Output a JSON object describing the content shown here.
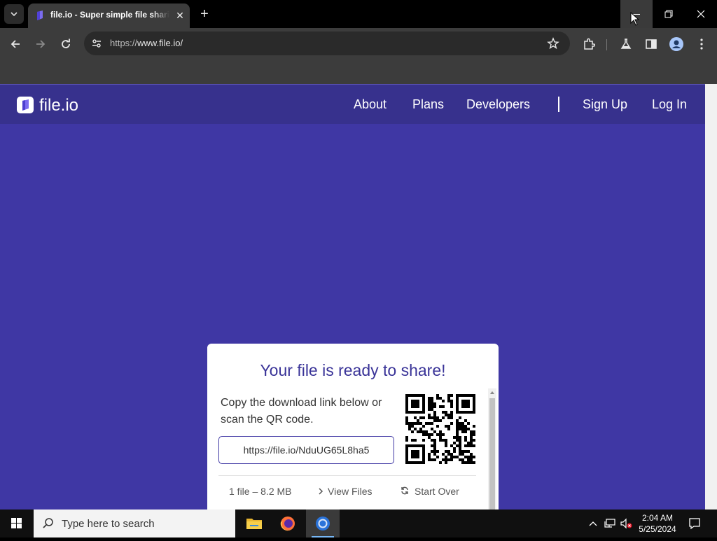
{
  "browser": {
    "tab_title": "file.io - Super simple file sharing",
    "url_prefix": "https://",
    "url_host": "www.file.io/"
  },
  "site": {
    "logo_text": "file.io",
    "nav": [
      "About",
      "Plans",
      "Developers",
      "Sign Up",
      "Log In"
    ]
  },
  "card": {
    "title": "Your file is ready to share!",
    "instructions": "Copy the download link below or scan the QR code.",
    "link": "https://file.io/NduUG65L8ha5",
    "file_count": "1 file – 8.2 MB",
    "view_files": "View Files",
    "start_over": "Start Over"
  },
  "taskbar": {
    "search_placeholder": "Type here to search",
    "time": "2:04 AM",
    "date": "5/25/2024"
  },
  "colors": {
    "page_bg": "#3f37a4",
    "header_bg": "#37318d",
    "title_color": "#3a3498"
  }
}
